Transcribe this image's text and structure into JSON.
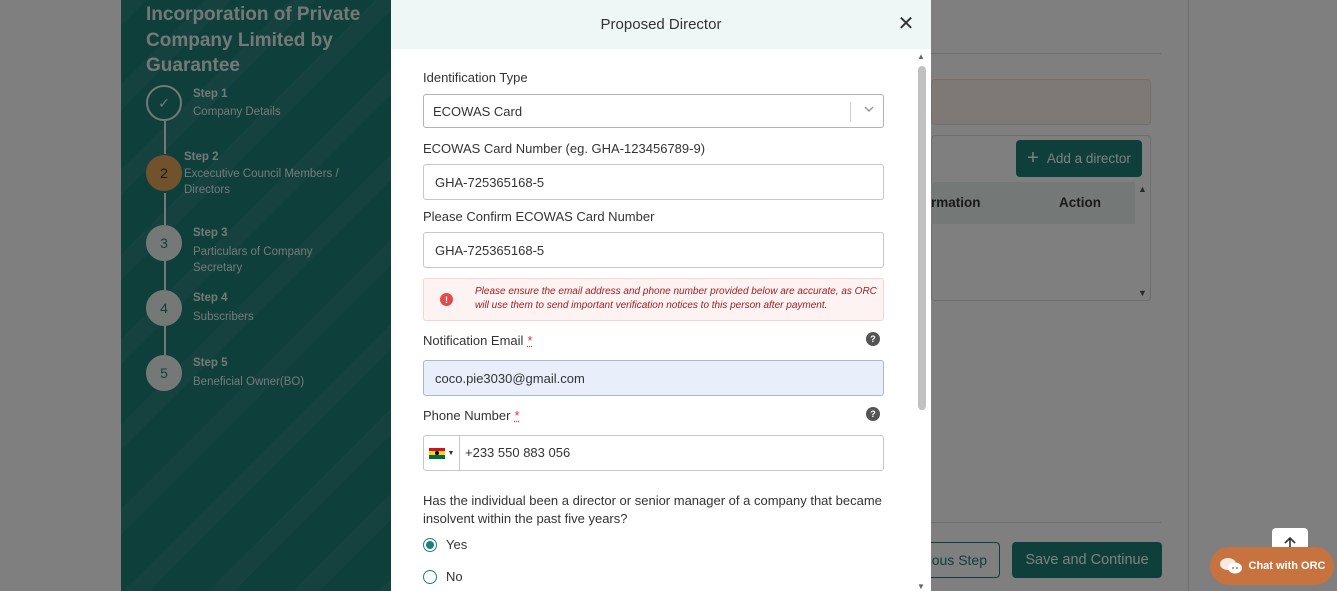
{
  "sidebar": {
    "title": "Incorporation of Private Company Limited by Guarantee",
    "steps": [
      {
        "label": "Step 1",
        "text": "Company Details",
        "num": "✓"
      },
      {
        "label": "Step 2",
        "text": "Excecutive Council Members / Directors",
        "num": "2"
      },
      {
        "label": "Step 3",
        "text": "Particulars of Company Secretary",
        "num": "3"
      },
      {
        "label": "Step 4",
        "text": "Subscribers",
        "num": "4"
      },
      {
        "label": "Step 5",
        "text": "Beneficial Owner(BO)",
        "num": "5"
      }
    ]
  },
  "background": {
    "add_director": "Add a director",
    "table_headers": [
      "rmation",
      "Action"
    ],
    "prev_step": "ous Step",
    "save_continue": "Save and Continue",
    "chat": "Chat with ORC"
  },
  "modal": {
    "title": "Proposed Director",
    "identification_type_label": "Identification Type",
    "identification_type_value": "ECOWAS Card",
    "card_number_label": "ECOWAS Card Number (eg. GHA-123456789-9)",
    "card_number_value": "GHA-725365168-5",
    "confirm_label": "Please Confirm ECOWAS Card Number",
    "confirm_value": "GHA-725365168-5",
    "warning": "Please ensure the email address and phone number provided below are accurate, as ORC will use them to send important verification notices to this person after payment.",
    "email_label": "Notification Email",
    "email_value": "coco.pie3030@gmail.com",
    "phone_label": "Phone Number",
    "phone_value": "+233 550 883 056",
    "required_mark": "*",
    "question": "Has the individual been a director or senior manager of a company that became insolvent within the past five years?",
    "option_yes": "Yes",
    "option_no": "No",
    "selected_option": "Yes"
  },
  "colors": {
    "primary": "#1f7f77",
    "accent": "#e2a55b",
    "warning": "#a32020",
    "chat": "#c8733f"
  }
}
